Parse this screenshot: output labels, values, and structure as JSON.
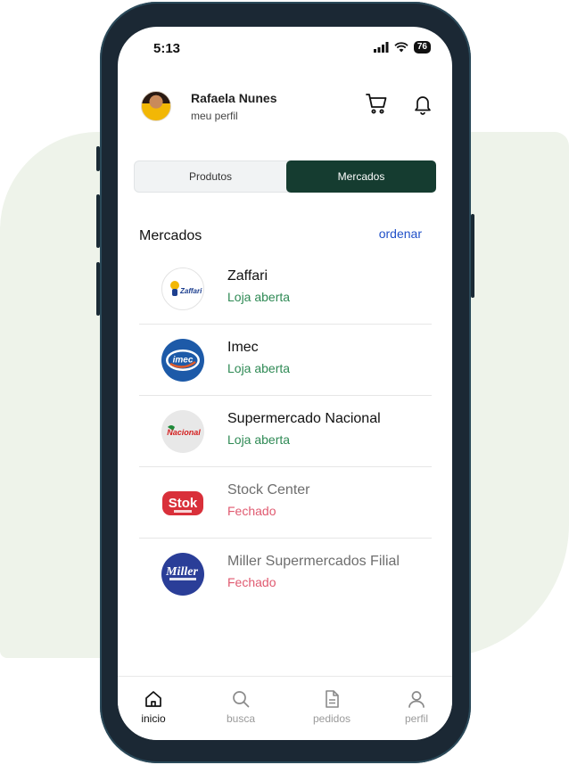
{
  "status_bar": {
    "time": "5:13",
    "battery": "76"
  },
  "header": {
    "user_name": "Rafaela Nunes",
    "user_subtitle": "meu perfil"
  },
  "tabs": [
    {
      "label": "Produtos",
      "active": false
    },
    {
      "label": "Mercados",
      "active": true
    }
  ],
  "section": {
    "title": "Mercados",
    "sort_label": "ordenar"
  },
  "markets": [
    {
      "name": "Zaffari",
      "status": "Loja aberta",
      "open": true,
      "logo_text": "Zaffari"
    },
    {
      "name": "Imec",
      "status": "Loja aberta",
      "open": true,
      "logo_text": "imec"
    },
    {
      "name": "Supermercado Nacional",
      "status": "Loja aberta",
      "open": true,
      "logo_text": "Nacional"
    },
    {
      "name": "Stock Center",
      "status": "Fechado",
      "open": false,
      "logo_text": "Stok"
    },
    {
      "name": "Miller Supermercados Filial",
      "status": "Fechado",
      "open": false,
      "logo_text": "Miller"
    }
  ],
  "bottom_nav": [
    {
      "label": "inicio",
      "icon": "home-icon",
      "active": true
    },
    {
      "label": "busca",
      "icon": "search-icon",
      "active": false
    },
    {
      "label": "pedidos",
      "icon": "document-icon",
      "active": false
    },
    {
      "label": "perfil",
      "icon": "user-icon",
      "active": false
    }
  ],
  "colors": {
    "accent_dark_green": "#153c30",
    "open_green": "#2f8a55",
    "closed_red": "#e05a70",
    "link_blue": "#2050c8",
    "background_shape": "#eef3ea"
  }
}
